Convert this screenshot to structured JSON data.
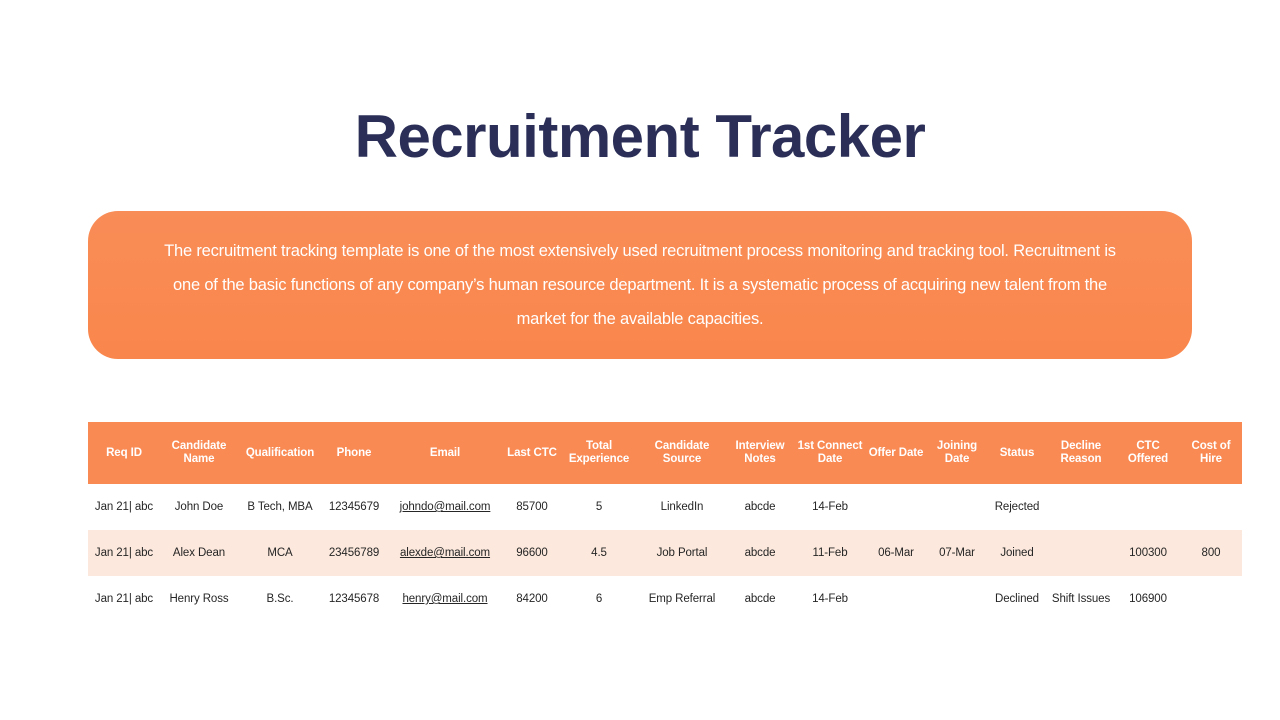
{
  "slide": {
    "title": "Recruitment Tracker",
    "description": "The recruitment tracking template is one of the most extensively used recruitment process monitoring and tracking tool. Recruitment is one of the basic functions of any company’s human resource department. It is a systematic process of acquiring new talent from the market for the available capacities."
  },
  "colors": {
    "title": "#2b2f58",
    "banner": "#f98a54",
    "header": "#f98a54",
    "row_alt": "#fce8dc",
    "text": "#262626"
  },
  "table": {
    "headers": [
      "Req ID",
      "Candidate Name",
      "Qualification",
      "Phone",
      "Email",
      "Last CTC",
      "Total Experience",
      "Candidate Source",
      "Interview Notes",
      "1st Connect Date",
      "Offer Date",
      "Joining Date",
      "Status",
      "Decline Reason",
      "CTC Offered",
      "Cost of Hire"
    ],
    "rows": [
      {
        "req_id": "Jan 21|  abc",
        "candidate_name": "John Doe",
        "qualification": "B Tech, MBA",
        "phone": "12345679",
        "email": "johndo@mail.com",
        "last_ctc": "85700",
        "total_experience": "5",
        "candidate_source": "LinkedIn",
        "interview_notes": "abcde",
        "first_connect_date": "14-Feb",
        "offer_date": "",
        "joining_date": "",
        "status": "Rejected",
        "decline_reason": "",
        "ctc_offered": "",
        "cost_of_hire": ""
      },
      {
        "req_id": "Jan 21|  abc",
        "candidate_name": "Alex Dean",
        "qualification": "MCA",
        "phone": "23456789",
        "email": "alexde@mail.com",
        "last_ctc": "96600",
        "total_experience": "4.5",
        "candidate_source": "Job Portal",
        "interview_notes": "abcde",
        "first_connect_date": "11-Feb",
        "offer_date": "06-Mar",
        "joining_date": "07-Mar",
        "status": "Joined",
        "decline_reason": "",
        "ctc_offered": "100300",
        "cost_of_hire": "800"
      },
      {
        "req_id": "Jan 21|  abc",
        "candidate_name": "Henry Ross",
        "qualification": "B.Sc.",
        "phone": "12345678",
        "email": "henry@mail.com",
        "last_ctc": "84200",
        "total_experience": "6",
        "candidate_source": "Emp Referral",
        "interview_notes": "abcde",
        "first_connect_date": "14-Feb",
        "offer_date": "",
        "joining_date": "",
        "status": "Declined",
        "decline_reason": "Shift Issues",
        "ctc_offered": "106900",
        "cost_of_hire": ""
      }
    ]
  }
}
